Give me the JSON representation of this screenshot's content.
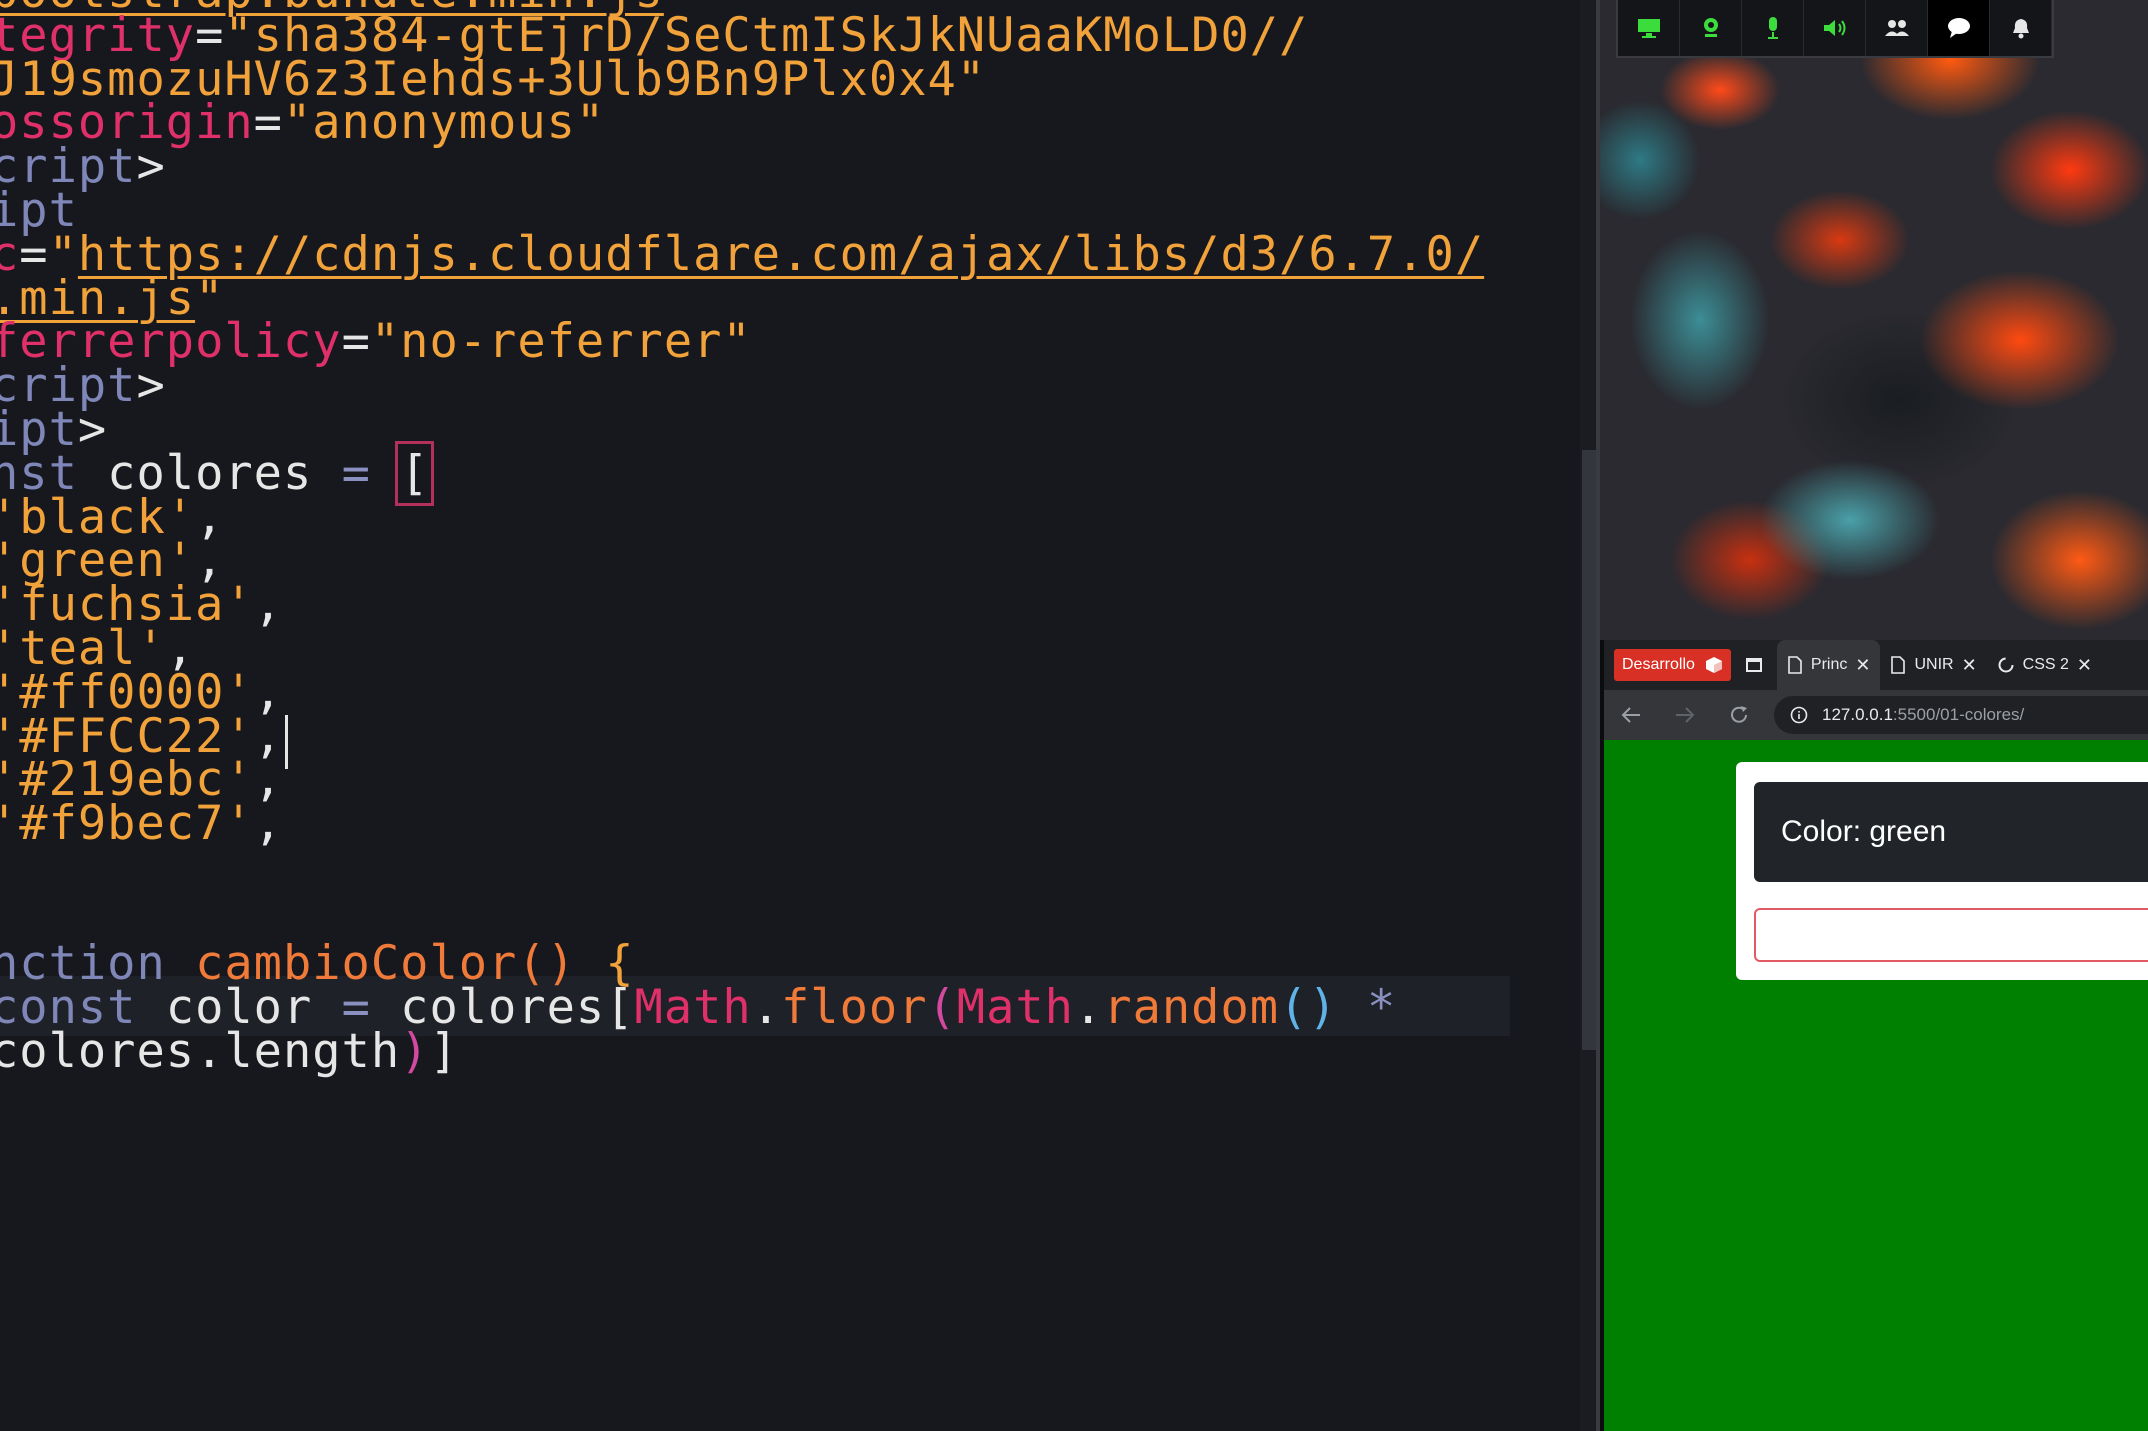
{
  "editor": {
    "lines": [
      [
        {
          "c": "url",
          "t": "bootstrap.bundle.min.js"
        }
      ],
      [
        {
          "c": "attr",
          "t": "tegrity"
        },
        {
          "c": "plain",
          "t": "="
        },
        {
          "c": "str",
          "t": "\"sha384-gtEjrD/SeCtmISkJkNUaaKMoLD0//"
        }
      ],
      [
        {
          "c": "str",
          "t": "J19smozuHV6z3Iehds+3Ulb9Bn9Plx0x4\""
        }
      ],
      [
        {
          "c": "attr",
          "t": "ossorigin"
        },
        {
          "c": "plain",
          "t": "="
        },
        {
          "c": "str",
          "t": "\"anonymous\""
        }
      ],
      [
        {
          "c": "tag",
          "t": "cript"
        },
        {
          "c": "plain",
          "t": ">"
        }
      ],
      [
        {
          "c": "tag",
          "t": "ipt"
        }
      ],
      [
        {
          "c": "attr",
          "t": "c"
        },
        {
          "c": "plain",
          "t": "="
        },
        {
          "c": "str",
          "t": "\""
        },
        {
          "c": "url",
          "t": "https://cdnjs.cloudflare.com/ajax/libs/d3/6.7.0/"
        }
      ],
      [
        {
          "c": "url",
          "t": ".min.js"
        },
        {
          "c": "str",
          "t": "\""
        }
      ],
      [
        {
          "c": "attr",
          "t": "ferrerpolicy"
        },
        {
          "c": "plain",
          "t": "="
        },
        {
          "c": "str",
          "t": "\"no-referrer\""
        }
      ],
      [
        {
          "c": "tag",
          "t": "cript"
        },
        {
          "c": "plain",
          "t": ">"
        }
      ],
      [
        {
          "c": "tag",
          "t": "ipt"
        },
        {
          "c": "plain",
          "t": ">"
        }
      ],
      [
        {
          "c": "kw",
          "t": "nst"
        },
        {
          "c": "plain",
          "t": " colores "
        },
        {
          "c": "op",
          "t": "="
        },
        {
          "c": "plain",
          "t": " "
        },
        {
          "c": "bracket",
          "t": "["
        }
      ],
      [
        {
          "c": "str",
          "t": "'black'"
        },
        {
          "c": "plain",
          "t": ","
        }
      ],
      [
        {
          "c": "str",
          "t": "'green'"
        },
        {
          "c": "plain",
          "t": ","
        }
      ],
      [
        {
          "c": "str",
          "t": "'fuchsia'"
        },
        {
          "c": "plain",
          "t": ","
        }
      ],
      [
        {
          "c": "str",
          "t": "'teal'"
        },
        {
          "c": "plain",
          "t": ","
        }
      ],
      [
        {
          "c": "str",
          "t": "'#ff0000'"
        },
        {
          "c": "plain",
          "t": ","
        }
      ],
      [
        {
          "c": "str",
          "t": "'#FFCC22'"
        },
        {
          "c": "plain",
          "t": ","
        }
      ],
      [
        {
          "c": "str",
          "t": "'#219ebc'"
        },
        {
          "c": "plain",
          "t": ","
        }
      ],
      [
        {
          "c": "str",
          "t": "'#f9bec7'"
        },
        {
          "c": "plain",
          "t": ","
        }
      ],
      [],
      [],
      [
        {
          "c": "kw",
          "t": "nction "
        },
        {
          "c": "fn",
          "t": "cambioColor"
        },
        {
          "c": "fn",
          "t": "() "
        },
        {
          "c": "brace",
          "t": "{"
        }
      ],
      [
        {
          "c": "kw",
          "t": "const"
        },
        {
          "c": "plain",
          "t": " color "
        },
        {
          "c": "op",
          "t": "="
        },
        {
          "c": "plain",
          "t": " colores["
        },
        {
          "c": "obj",
          "t": "Math"
        },
        {
          "c": "plain",
          "t": "."
        },
        {
          "c": "fn",
          "t": "floor"
        },
        {
          "c": "paren",
          "t": "("
        },
        {
          "c": "obj",
          "t": "Math"
        },
        {
          "c": "plain",
          "t": "."
        },
        {
          "c": "fn",
          "t": "random"
        },
        {
          "c": "paren2",
          "t": "()"
        },
        {
          "c": "op",
          "t": " *"
        }
      ],
      [
        {
          "c": "plain",
          "t": "colores.length"
        },
        {
          "c": "paren",
          "t": ")"
        },
        {
          "c": "plain",
          "t": "]"
        }
      ]
    ]
  },
  "toolbar": {
    "buttons": [
      {
        "icon": "monitor-icon",
        "color": "#3ddc3d"
      },
      {
        "icon": "webcam-icon",
        "color": "#3ddc3d"
      },
      {
        "icon": "microphone-icon",
        "color": "#3ddc3d"
      },
      {
        "icon": "speaker-icon",
        "color": "#3ddc3d"
      },
      {
        "icon": "users-icon",
        "color": "#e6e6e6"
      },
      {
        "icon": "chat-icon",
        "color": "#ffffff"
      },
      {
        "icon": "bell-icon",
        "color": "#e6e6e6"
      }
    ]
  },
  "browser": {
    "profile_label": "Desarrollo",
    "tabs": [
      {
        "label": "Princ",
        "active": true
      },
      {
        "label": "UNIR",
        "active": false
      },
      {
        "label": "CSS 2",
        "active": false
      }
    ],
    "url_host": "127.0.0.1",
    "url_path": ":5500/01-colores/",
    "page_background": "#008000",
    "color_label": "Color: green",
    "input_value": ""
  }
}
